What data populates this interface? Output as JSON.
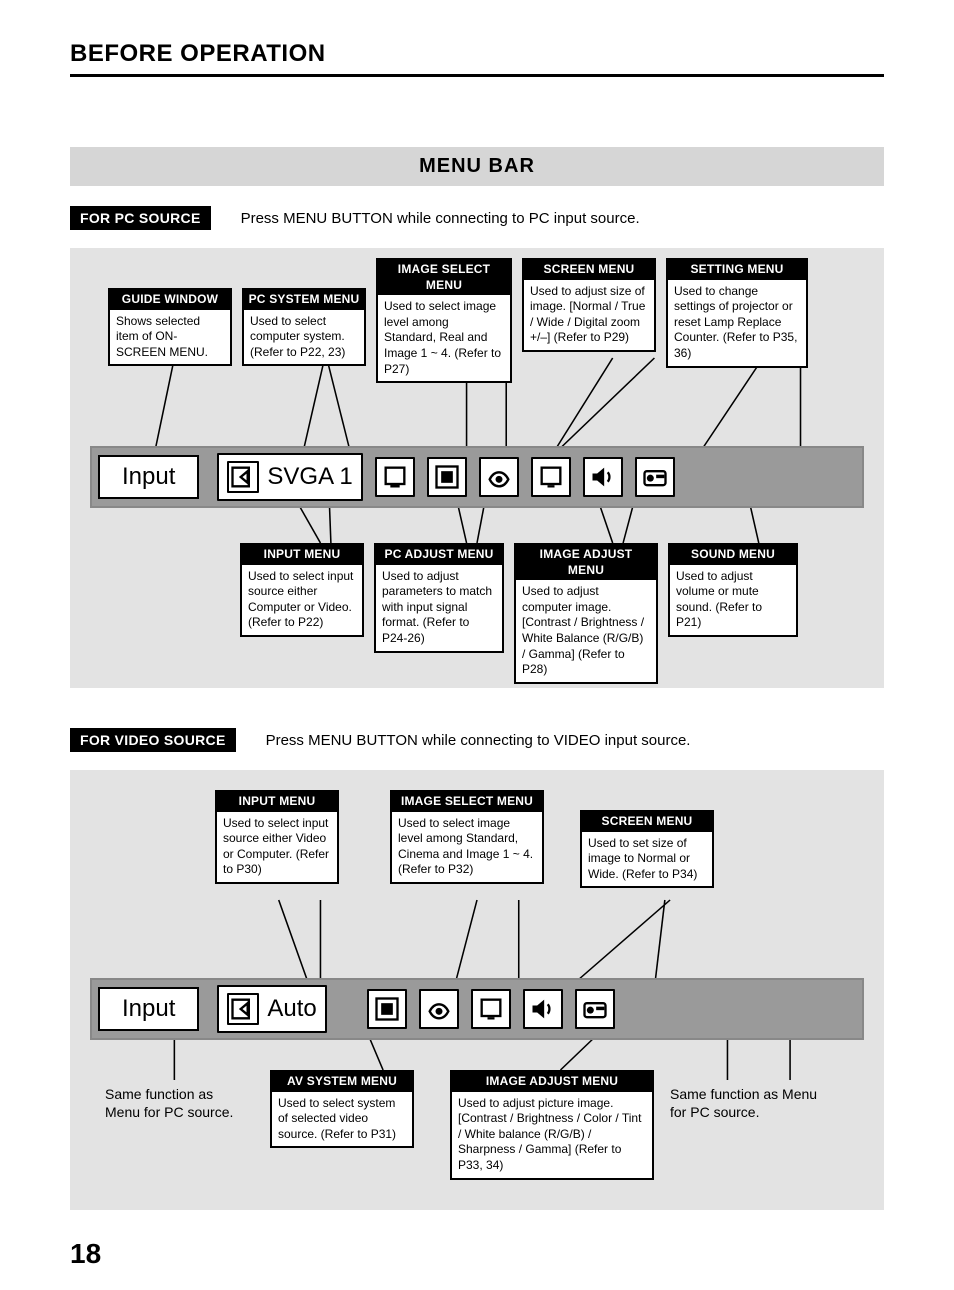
{
  "header": "BEFORE OPERATION",
  "section_title": "MENU BAR",
  "page_number": "18",
  "pc": {
    "source_label": "FOR PC SOURCE",
    "source_desc": "Press MENU BUTTON while connecting to PC input source.",
    "menubar_label": "Input",
    "menubar_system": "SVGA 1",
    "top": {
      "guide": {
        "title": "GUIDE WINDOW",
        "body": "Shows selected item of ON-SCREEN MENU."
      },
      "pc_system": {
        "title": "PC SYSTEM MENU",
        "body": "Used to select computer system. (Refer to P22, 23)"
      },
      "image_select": {
        "title": "IMAGE SELECT MENU",
        "body": "Used to select image level among Standard, Real and Image 1 ~ 4. (Refer to P27)"
      },
      "screen": {
        "title": "SCREEN MENU",
        "body": "Used to adjust size of image.  [Normal / True / Wide / Digital zoom +/–] (Refer to P29)"
      },
      "setting": {
        "title": "SETTING MENU",
        "body": "Used to change settings of projector or reset Lamp Replace Counter. (Refer to P35, 36)"
      }
    },
    "bottom": {
      "input": {
        "title": "INPUT MENU",
        "body": "Used to select input source either Computer or Video. (Refer to P22)"
      },
      "pc_adjust": {
        "title": "PC ADJUST MENU",
        "body": "Used to adjust parameters to match with input signal format. (Refer to P24-26)"
      },
      "image_adjust": {
        "title": "IMAGE ADJUST MENU",
        "body": "Used to adjust computer image. [Contrast / Brightness / White Balance (R/G/B) / Gamma] (Refer to P28)"
      },
      "sound": {
        "title": "SOUND MENU",
        "body": "Used to adjust volume or mute sound. (Refer to P21)"
      }
    }
  },
  "video": {
    "source_label": "FOR VIDEO SOURCE",
    "source_desc": "Press MENU BUTTON while connecting to VIDEO input source.",
    "menubar_label": "Input",
    "menubar_system": "Auto",
    "top": {
      "input": {
        "title": "INPUT MENU",
        "body": "Used to select input source either Video or Computer. (Refer to P30)"
      },
      "image_select": {
        "title": "IMAGE SELECT MENU",
        "body": "Used to select image level among Standard, Cinema and Image 1 ~ 4. (Refer to P32)"
      },
      "screen": {
        "title": "SCREEN MENU",
        "body": "Used to set size of image to Normal or Wide. (Refer to P34)"
      }
    },
    "bottom": {
      "av_system": {
        "title": "AV SYSTEM MENU",
        "body": "Used to select system of selected video source. (Refer to P31)"
      },
      "image_adjust": {
        "title": "IMAGE ADJUST MENU",
        "body": "Used to adjust picture image. [Contrast / Brightness / Color / Tint / White balance (R/G/B) / Sharpness / Gamma] (Refer to P33, 34)"
      }
    },
    "note_left": "Same function as Menu for PC source.",
    "note_right": "Same function as Menu for PC source."
  },
  "icons": {
    "input": "input-arrow-icon",
    "image_select": "image-select-icon",
    "screen": "screen-icon",
    "image_adjust": "image-adjust-icon",
    "pc_adjust": "pc-adjust-icon",
    "sound": "sound-icon",
    "setting": "setting-icon"
  }
}
